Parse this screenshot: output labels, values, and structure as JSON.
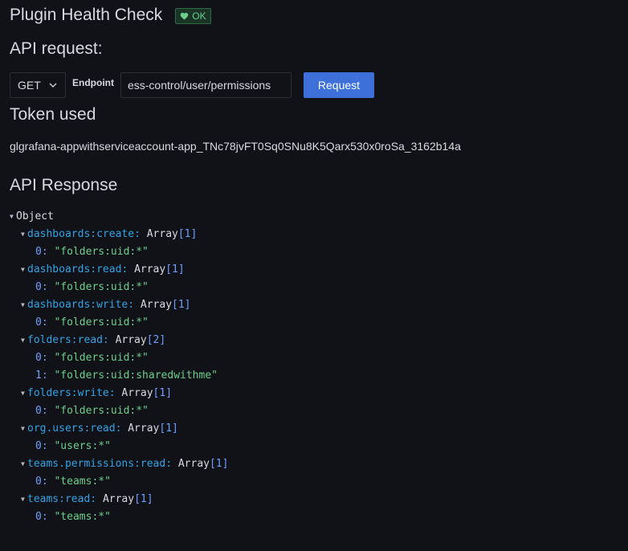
{
  "header": {
    "title": "Plugin Health Check",
    "status_badge": "OK"
  },
  "request": {
    "heading": "API request:",
    "method": "GET",
    "endpoint_label": "Endpoint",
    "endpoint_value": "/api/access-control/user/permissions",
    "endpoint_visible": "ess-control/user/permissions",
    "button_label": "Request"
  },
  "token": {
    "heading": "Token used",
    "value": "glgrafana-appwithserviceaccount-app_TNc78jvFT0Sq0SNu8K5Qarx530x0roSa_3162b14a"
  },
  "response": {
    "heading": "API Response",
    "root_label": "Object",
    "entries": [
      {
        "key": "dashboards:create",
        "type": "Array",
        "count": "[1]",
        "items": [
          {
            "index": "0",
            "value": "\"folders:uid:*\""
          }
        ]
      },
      {
        "key": "dashboards:read",
        "type": "Array",
        "count": "[1]",
        "items": [
          {
            "index": "0",
            "value": "\"folders:uid:*\""
          }
        ]
      },
      {
        "key": "dashboards:write",
        "type": "Array",
        "count": "[1]",
        "items": [
          {
            "index": "0",
            "value": "\"folders:uid:*\""
          }
        ]
      },
      {
        "key": "folders:read",
        "type": "Array",
        "count": "[2]",
        "items": [
          {
            "index": "0",
            "value": "\"folders:uid:*\""
          },
          {
            "index": "1",
            "value": "\"folders:uid:sharedwithme\""
          }
        ]
      },
      {
        "key": "folders:write",
        "type": "Array",
        "count": "[1]",
        "items": [
          {
            "index": "0",
            "value": "\"folders:uid:*\""
          }
        ]
      },
      {
        "key": "org.users:read",
        "type": "Array",
        "count": "[1]",
        "items": [
          {
            "index": "0",
            "value": "\"users:*\""
          }
        ]
      },
      {
        "key": "teams.permissions:read",
        "type": "Array",
        "count": "[1]",
        "items": [
          {
            "index": "0",
            "value": "\"teams:*\""
          }
        ]
      },
      {
        "key": "teams:read",
        "type": "Array",
        "count": "[1]",
        "items": [
          {
            "index": "0",
            "value": "\"teams:*\""
          }
        ]
      }
    ]
  },
  "icons": {
    "badge": "heart-icon",
    "select": "chevron-down-icon",
    "tree_toggle": "caret-down-icon"
  },
  "colors": {
    "background": "#111217",
    "primary_button": "#3d71d9",
    "ok_green": "#6ccf8e",
    "json_key": "#33a2e5",
    "json_string": "#6ccf8e"
  }
}
